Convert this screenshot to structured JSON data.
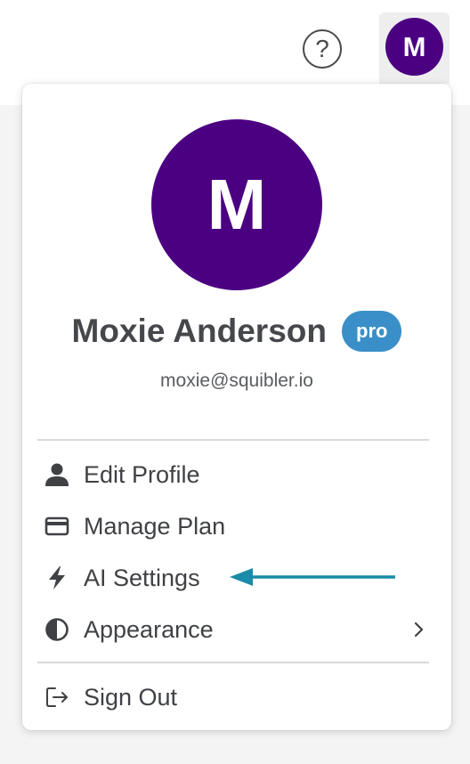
{
  "header": {
    "help_glyph": "?",
    "avatar_initial": "M",
    "avatar_color": "#4b0082"
  },
  "profile": {
    "initial": "M",
    "name": "Moxie Anderson",
    "badge": "pro",
    "badge_color": "#3a8fc9",
    "email": "moxie@squibler.io"
  },
  "menu": {
    "items": [
      {
        "label": "Edit Profile",
        "icon": "person-icon"
      },
      {
        "label": "Manage Plan",
        "icon": "credit-card-icon"
      },
      {
        "label": "AI Settings",
        "icon": "lightning-bolt-icon"
      },
      {
        "label": "Appearance",
        "icon": "contrast-icon",
        "submenu": true
      }
    ],
    "sign_out": {
      "label": "Sign Out",
      "icon": "sign-out-icon"
    }
  },
  "annotation": {
    "arrow_color": "#1a8ba8",
    "points_to": "AI Settings"
  }
}
